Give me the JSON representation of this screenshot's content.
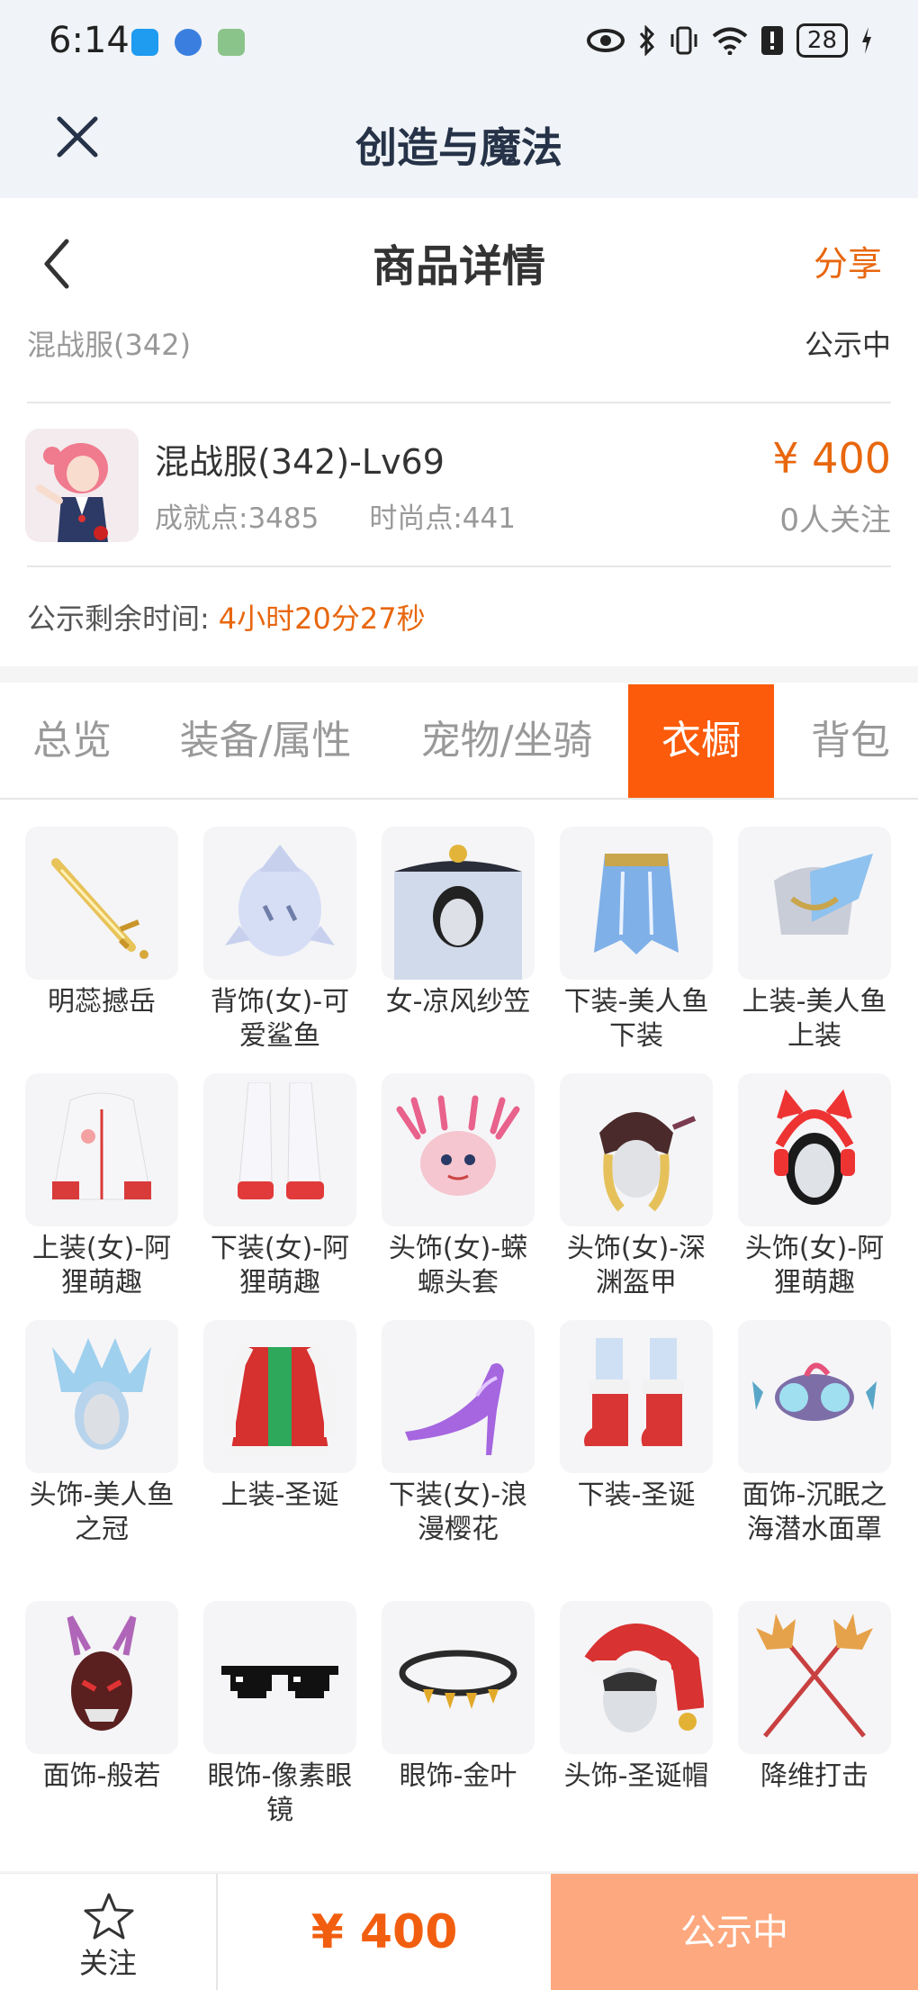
{
  "status_bar": {
    "time": "6:14",
    "battery": "28"
  },
  "app_bar": {
    "title": "创造与魔法"
  },
  "header": {
    "title": "商品详情",
    "share_label": "分享",
    "server": "混战服(342)",
    "status": "公示中"
  },
  "role": {
    "name": "混战服(342)-Lv69",
    "achievement": "成就点:3485",
    "fashion": "时尚点:441",
    "price": "¥ 400",
    "followers": "0人关注"
  },
  "countdown": {
    "label": "公示剩余时间:",
    "value": "4小时20分27秒"
  },
  "tabs": [
    {
      "label": "总览"
    },
    {
      "label": "装备/属性"
    },
    {
      "label": "宠物/坐骑"
    },
    {
      "label": "衣橱"
    },
    {
      "label": "背包"
    }
  ],
  "items": [
    {
      "name": "明蕊撼岳"
    },
    {
      "name": "背饰(女)-可爱鲨鱼"
    },
    {
      "name": "女-凉风纱笠"
    },
    {
      "name": "下装-美人鱼下装"
    },
    {
      "name": "上装-美人鱼上装"
    },
    {
      "name": "上装(女)-阿狸萌趣"
    },
    {
      "name": "下装(女)-阿狸萌趣"
    },
    {
      "name": "头饰(女)-蝾螈头套"
    },
    {
      "name": "头饰(女)-深渊盔甲"
    },
    {
      "name": "头饰(女)-阿狸萌趣"
    },
    {
      "name": "头饰-美人鱼之冠"
    },
    {
      "name": "上装-圣诞"
    },
    {
      "name": "下装(女)-浪漫樱花"
    },
    {
      "name": "下装-圣诞"
    },
    {
      "name": "面饰-沉眠之海潜水面罩"
    },
    {
      "name": "面饰-般若"
    },
    {
      "name": "眼饰-像素眼镜"
    },
    {
      "name": "眼饰-金叶"
    },
    {
      "name": "头饰-圣诞帽"
    },
    {
      "name": "降维打击"
    }
  ],
  "bottom_bar": {
    "follow_label": "关注",
    "price": "¥ 400",
    "action_label": "公示中"
  },
  "colors": {
    "accent": "#e8670e",
    "tab_active": "#fb5b0a",
    "action_button": "#fda87e"
  }
}
